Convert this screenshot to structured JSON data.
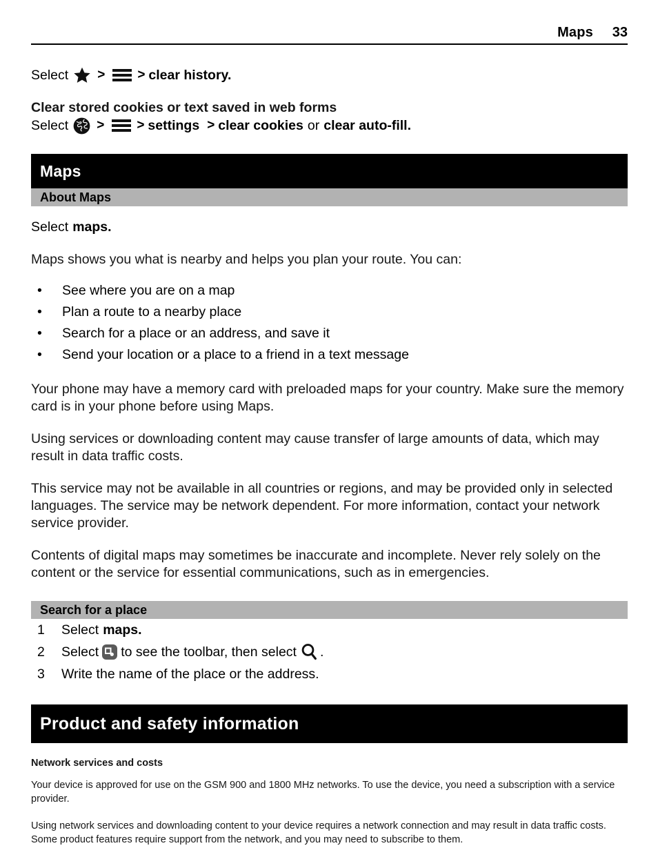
{
  "header": {
    "chapter": "Maps",
    "page_number": "33"
  },
  "clear_history": {
    "select_label": "Select",
    "sep": ">",
    "star_icon": "star-icon",
    "menu_icon": "hamburger-menu-icon",
    "action": "clear history."
  },
  "cookies_section": {
    "heading": "Clear stored cookies or text saved in web forms",
    "select_label": "Select",
    "sep": ">",
    "globe_icon": "globe-icon",
    "menu_icon": "hamburger-menu-icon",
    "settings": "settings",
    "clear_cookies": "clear cookies",
    "or": "or",
    "clear_autofill": "clear auto-fill."
  },
  "maps_chapter": {
    "banner_title": "Maps",
    "about_bar": "About Maps",
    "select_line_prefix": "Select",
    "select_line_bold": "maps.",
    "intro": "Maps shows you what is nearby and helps you plan your route. You can:",
    "bullet_marker": "•",
    "bullets": [
      "See where you are on a map",
      "Plan a route to a nearby place",
      "Search for a place or an address, and save it",
      "Send your location or a place to a friend in a text message"
    ],
    "paragraphs": [
      "Your phone may have a memory card with preloaded maps for your country. Make sure the memory card is in your phone before using Maps.",
      "Using services or downloading content may cause transfer of large amounts of data, which may result in data traffic costs.",
      "This service may not be available in all countries or regions, and may be provided only in selected languages. The service may be network dependent. For more information, contact your network service provider.",
      "Contents of digital maps may sometimes be inaccurate and incomplete. Never rely solely on the content or the service for essential communications, such as in emergencies."
    ]
  },
  "search_place": {
    "bar_title": "Search for a place",
    "step1": {
      "num": "1",
      "prefix": "Select",
      "bold": "maps."
    },
    "step2": {
      "num": "2",
      "prefix": "Select",
      "toolbar_icon": "toolbar-icon",
      "middle": "to see the toolbar, then select",
      "search_icon": "search-icon",
      "suffix": "."
    },
    "step3": {
      "num": "3",
      "text": "Write the name of the place or the address."
    }
  },
  "product_safety": {
    "banner_title": "Product and safety information",
    "subheading": "Network services and costs",
    "paragraphs": [
      "Your device is approved for use on the GSM 900 and 1800 MHz networks. To use the device, you need a subscription with a service provider.",
      "Using network services and downloading content to your device requires a network connection and may result in data traffic costs. Some product features require support from the network, and you may need to subscribe to them."
    ]
  },
  "colors": {
    "banner_bg": "#000000",
    "banner_text": "#ffffff",
    "section_bar_bg": "#b2b2b2",
    "body_text": "#171717",
    "toolbar_icon_bg": "#5a5a5a"
  }
}
